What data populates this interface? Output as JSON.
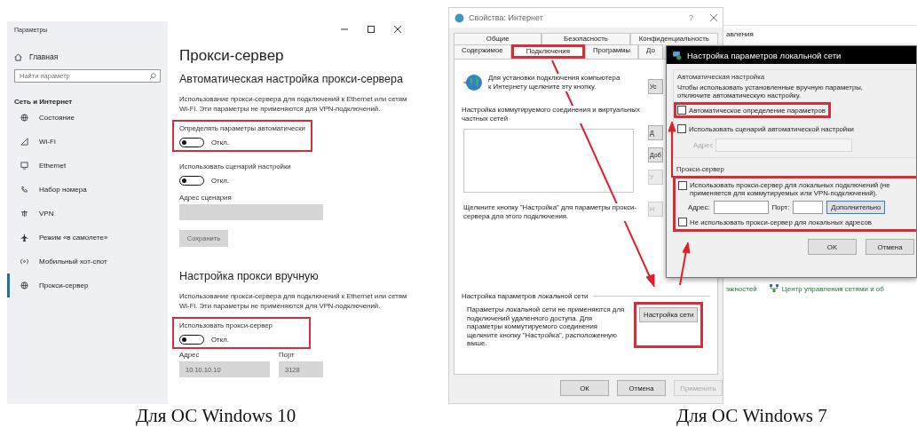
{
  "windows10": {
    "caption": "Для ОС Windows 10",
    "title": "Параметры",
    "sidebar": {
      "home": "Главная",
      "search_placeholder": "Найти параметр",
      "section": "Сеть и Интернет",
      "items": [
        {
          "label": "Состояние",
          "selected": false
        },
        {
          "label": "Wi-Fi",
          "selected": false
        },
        {
          "label": "Ethernet",
          "selected": false
        },
        {
          "label": "Набор номера",
          "selected": false
        },
        {
          "label": "VPN",
          "selected": false
        },
        {
          "label": "Режим «в самолете»",
          "selected": false
        },
        {
          "label": "Мобильный хот-спот",
          "selected": false
        },
        {
          "label": "Прокси-сервер",
          "selected": true
        }
      ]
    },
    "page_title": "Прокси-сервер",
    "auto": {
      "heading": "Автоматическая настройка прокси-сервера",
      "description": "Использование прокси-сервера для подключений к Ethernet или сетям Wi-Fi. Эти параметры не применяются для VPN-подключений.",
      "settings": [
        {
          "label": "Определять параметры автоматически",
          "on": false,
          "state_text": "Откл.",
          "highlighted": true
        },
        {
          "label": "Использовать сценарий настройки",
          "on": false,
          "state_text": "Откл.",
          "highlighted": false
        }
      ],
      "script_address_label": "Адрес сценария",
      "save_button": {
        "label": "Сохранить",
        "disabled": true
      }
    },
    "manual": {
      "heading": "Настройка прокси вручную",
      "description": "Использование прокси-сервера для подключений к Ethernet или сетям Wi-Fi. Эти параметры не применяются для VPN-подключений.",
      "setting": {
        "label": "Использовать прокси-сервер",
        "on": false,
        "state_text": "Откл.",
        "highlighted": true
      },
      "address": {
        "label": "Адрес",
        "value": "10.10.10.10"
      },
      "port": {
        "label": "Порт",
        "value": "3128"
      }
    }
  },
  "windows7": {
    "caption": "Для ОС Windows 7",
    "internet_properties": {
      "title": "Свойства: Интернет",
      "help": "?",
      "tab_rows": [
        [
          {
            "label": "Общие",
            "selected": false,
            "highlighted": false
          },
          {
            "label": "Безопасность",
            "selected": false,
            "highlighted": false
          },
          {
            "label": "Конфиденциальность",
            "selected": false,
            "highlighted": false
          }
        ],
        [
          {
            "label": "Содержимое",
            "selected": false,
            "highlighted": false
          },
          {
            "label": "Подключения",
            "selected": true,
            "highlighted": true
          },
          {
            "label": "Программы",
            "selected": false,
            "highlighted": false
          },
          {
            "label": "До",
            "selected": false,
            "highlighted": false
          }
        ]
      ],
      "setup_text": "Для установки подключения компьютера к Интернету щелкните эту кнопку.",
      "setup_button": {
        "label": "Ус"
      },
      "dialup_heading": "Настройка коммутируемого соединения и виртуальных частных сетей",
      "side_buttons": [
        {
          "label": "Д",
          "disabled": false
        },
        {
          "label": "Доб",
          "disabled": false
        },
        {
          "label": "У",
          "disabled": true
        }
      ],
      "settings_hint": "Щелкните кнопку \"Настройка\" для параметры прокси-сервера для этого подключения.",
      "settings_button": {
        "label": "Н",
        "disabled": true
      },
      "lan_heading": "Настройка параметров локальной сети",
      "lan_text": "Параметры локальной сети не применяются для подключений удаленного доступа. Для параметры коммутируемого соединения щелкните кнопку \"Настройка\", расположенную выше.",
      "lan_button": {
        "label": "Настройка сети",
        "highlighted": true
      },
      "buttons": [
        {
          "label": "ОК",
          "disabled": false
        },
        {
          "label": "Отмена",
          "disabled": false
        },
        {
          "label": "Применить",
          "disabled": true
        }
      ]
    },
    "background_window": {
      "top_text": "авления",
      "bottom_text": "эжностей",
      "link": "Центр управления сетями и об"
    },
    "lan_dialog": {
      "title": "Настройка параметров локальной сети",
      "auto_group": {
        "legend": "Автоматическая настройка",
        "text": "Чтобы использовать установленные вручную параметры, отключите автоматическую настройку.",
        "options": [
          {
            "label": "Автоматическое определение параметров",
            "checked": false,
            "highlighted": true
          },
          {
            "label": "Использовать сценарий автоматической настройки",
            "checked": false,
            "highlighted": false
          }
        ],
        "address_label": "Адрес"
      },
      "proxy_group": {
        "legend": "Прокси-сервер",
        "highlighted": true,
        "use_proxy": {
          "label": "Использовать прокси-сервер для локальных подключений (не применяется для коммутируемых или VPN-подключений).",
          "checked": false
        },
        "address_label": "Адрес:",
        "port_label": "Порт:",
        "advanced_button": "Дополнительно",
        "bypass": {
          "label": "Не использовать прокси-сервер для локальных адресов",
          "checked": false
        }
      },
      "buttons": [
        {
          "label": "OK"
        },
        {
          "label": "Отмена"
        }
      ]
    }
  }
}
